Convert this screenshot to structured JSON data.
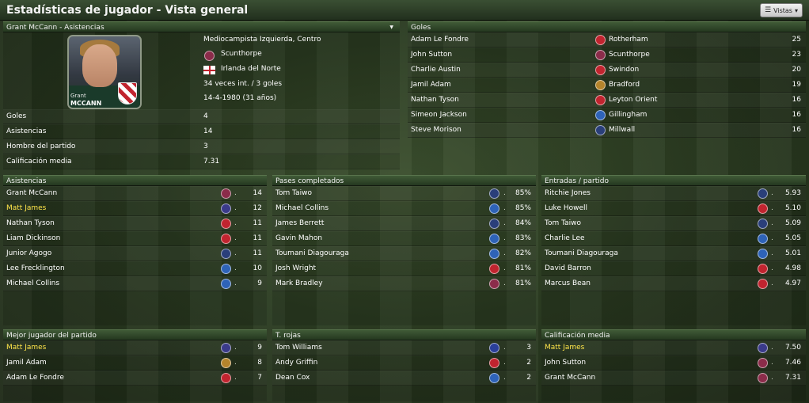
{
  "header": {
    "title": "Estadísticas de jugador - Vista general",
    "views_label": "Vistas"
  },
  "profile": {
    "title": "Grant McCann - Asistencias",
    "photo_caption_top": "Grant",
    "photo_caption_bottom": "MCCANN",
    "position": "Mediocampista Izquierda, Centro",
    "club": "Scunthorpe",
    "nation": "Irlanda del Norte",
    "caps": "34 veces int. / 3 goles",
    "birth": "14-4-1980 (31 años)",
    "stats": [
      {
        "label": "Goles",
        "value": "4"
      },
      {
        "label": "Asistencias",
        "value": "14"
      },
      {
        "label": "Hombre del partido",
        "value": "3"
      },
      {
        "label": "Calificación media",
        "value": "7.31"
      }
    ]
  },
  "goals": {
    "title": "Goles",
    "rows": [
      {
        "name": "Adam Le Fondre",
        "club": "Rotherham",
        "value": "25",
        "color": "#c1242f"
      },
      {
        "name": "John Sutton",
        "club": "Scunthorpe",
        "value": "23",
        "color": "#8b2c4a"
      },
      {
        "name": "Charlie Austin",
        "club": "Swindon",
        "value": "20",
        "color": "#c1242f"
      },
      {
        "name": "Jamil Adam",
        "club": "Bradford",
        "value": "19",
        "color": "#b5842c"
      },
      {
        "name": "Nathan Tyson",
        "club": "Leyton Orient",
        "value": "16",
        "color": "#c1242f"
      },
      {
        "name": "Simeon Jackson",
        "club": "Gillingham",
        "value": "16",
        "color": "#2e63b8"
      },
      {
        "name": "Steve Morison",
        "club": "Millwall",
        "value": "16",
        "color": "#2a3f7a"
      }
    ]
  },
  "assists": {
    "title": "Asistencias",
    "rows": [
      {
        "name": "Grant McCann",
        "value": "14",
        "color": "#8b2c4a",
        "hl": false
      },
      {
        "name": "Matt James",
        "value": "12",
        "color": "#3a3a8a",
        "hl": true
      },
      {
        "name": "Nathan Tyson",
        "value": "11",
        "color": "#c1242f",
        "hl": false
      },
      {
        "name": "Liam Dickinson",
        "value": "11",
        "color": "#c1242f",
        "hl": false
      },
      {
        "name": "Junior Agogo",
        "value": "11",
        "color": "#2a3f7a",
        "hl": false
      },
      {
        "name": "Lee Frecklington",
        "value": "10",
        "color": "#2e63b8",
        "hl": false
      },
      {
        "name": "Michael Collins",
        "value": "9",
        "color": "#2e63b8",
        "hl": false
      }
    ]
  },
  "passes": {
    "title": "Pases completados",
    "rows": [
      {
        "name": "Tom Taiwo",
        "value": "85%",
        "color": "#2a3f7a"
      },
      {
        "name": "Michael Collins",
        "value": "85%",
        "color": "#2e63b8"
      },
      {
        "name": "James Berrett",
        "value": "84%",
        "color": "#2a3f7a"
      },
      {
        "name": "Gavin Mahon",
        "value": "83%",
        "color": "#2e63b8"
      },
      {
        "name": "Toumani Diagouraga",
        "value": "82%",
        "color": "#2e63b8"
      },
      {
        "name": "Josh Wright",
        "value": "81%",
        "color": "#c1242f"
      },
      {
        "name": "Mark Bradley",
        "value": "81%",
        "color": "#8b2c4a"
      }
    ]
  },
  "tackles": {
    "title": "Entradas / partido",
    "rows": [
      {
        "name": "Ritchie Jones",
        "value": "5.93",
        "color": "#2a3f7a"
      },
      {
        "name": "Luke Howell",
        "value": "5.10",
        "color": "#c1242f"
      },
      {
        "name": "Tom Taiwo",
        "value": "5.09",
        "color": "#2a3f7a"
      },
      {
        "name": "Charlie Lee",
        "value": "5.05",
        "color": "#2e63b8"
      },
      {
        "name": "Toumani Diagouraga",
        "value": "5.01",
        "color": "#2e63b8"
      },
      {
        "name": "David Barron",
        "value": "4.98",
        "color": "#c1242f"
      },
      {
        "name": "Marcus Bean",
        "value": "4.97",
        "color": "#c1242f"
      }
    ]
  },
  "motm": {
    "title": "Mejor jugador del partido",
    "rows": [
      {
        "name": "Matt James",
        "value": "9",
        "color": "#3a3a8a",
        "hl": true
      },
      {
        "name": "Jamil Adam",
        "value": "8",
        "color": "#b5842c",
        "hl": false
      },
      {
        "name": "Adam Le Fondre",
        "value": "7",
        "color": "#c1242f",
        "hl": false
      }
    ]
  },
  "redcards": {
    "title": "T. rojas",
    "rows": [
      {
        "name": "Tom Williams",
        "value": "3",
        "color": "#2a3f9a"
      },
      {
        "name": "Andy Griffin",
        "value": "2",
        "color": "#c1242f"
      },
      {
        "name": "Dean Cox",
        "value": "2",
        "color": "#2e63b8"
      }
    ]
  },
  "rating": {
    "title": "Calificación media",
    "rows": [
      {
        "name": "Matt James",
        "value": "7.50",
        "color": "#3a3a8a",
        "hl": true
      },
      {
        "name": "John Sutton",
        "value": "7.46",
        "color": "#8b2c4a",
        "hl": false
      },
      {
        "name": "Grant McCann",
        "value": "7.31",
        "color": "#8b2c4a",
        "hl": false
      }
    ]
  }
}
